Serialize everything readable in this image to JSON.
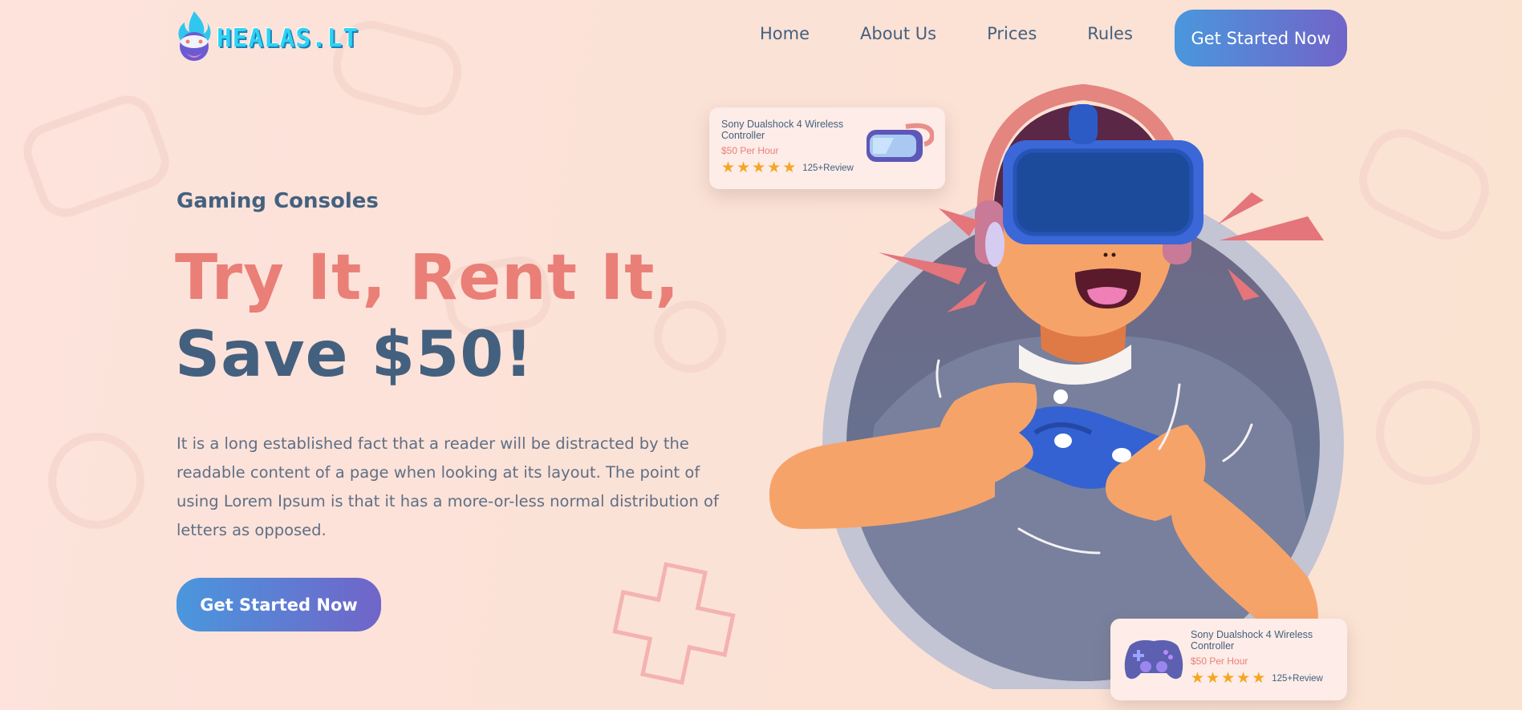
{
  "brand": {
    "name": "HEALAS.LT",
    "logo_icon": "gamer-flame-mascot-icon"
  },
  "nav": {
    "items": [
      {
        "label": "Home"
      },
      {
        "label": "About Us"
      },
      {
        "label": "Prices"
      },
      {
        "label": "Rules"
      }
    ],
    "cta_label": "Get Started Now"
  },
  "hero": {
    "eyebrow": "Gaming Consoles",
    "headline_line1": "Try It, Rent It,",
    "headline_line2": "Save $50!",
    "description": "It is a long established fact that a reader will be distracted by the readable content of a page when looking at its layout. The point of using Lorem Ipsum is that it has a more-or-less normal distribution of letters as opposed.",
    "cta_label": "Get Started Now",
    "illustration": "vr-gamer-with-controller-illustration"
  },
  "cards": [
    {
      "title": "Sony Dualshock 4 Wireless Controller",
      "price": "$50 Per Hour",
      "rating": 5,
      "reviews": "125+Review",
      "thumb_icon": "vr-headset-icon"
    },
    {
      "title": "Sony Dualshock 4 Wireless Controller",
      "price": "$50 Per Hour",
      "rating": 5,
      "reviews": "125+Review",
      "thumb_icon": "gamepad-icon"
    }
  ],
  "colors": {
    "accent_coral": "#ea7f78",
    "text_navy": "#44607f",
    "button_gradient_start": "#4a97dd",
    "button_gradient_end": "#7164c8",
    "star": "#f5a623"
  }
}
